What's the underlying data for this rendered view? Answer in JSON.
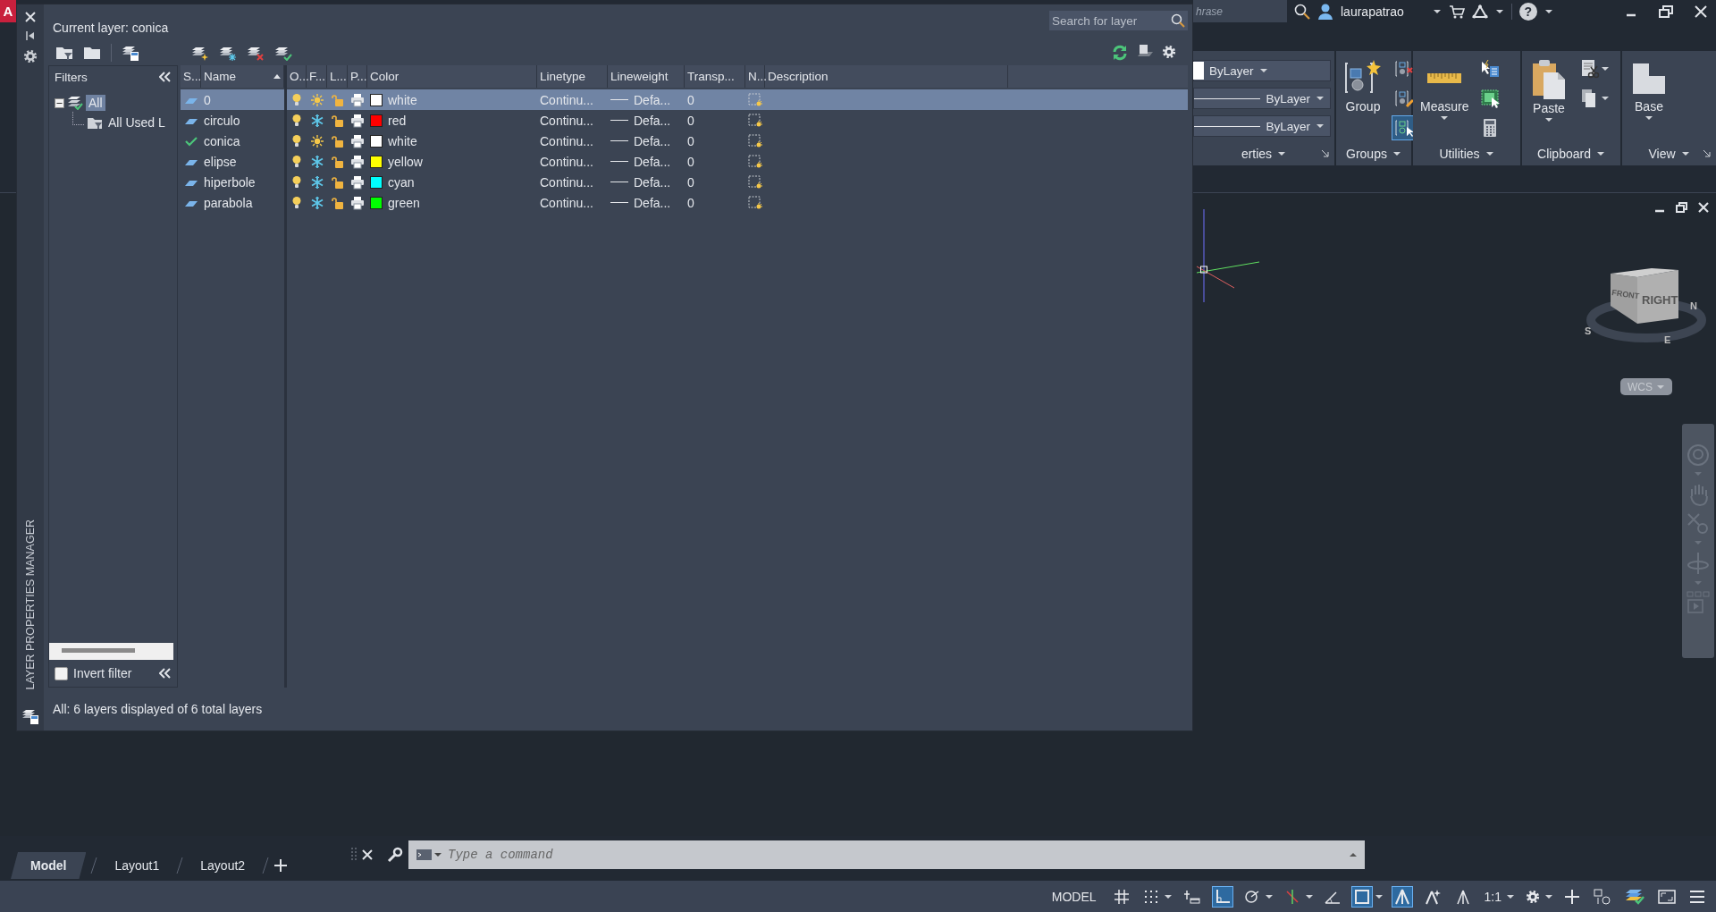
{
  "app_bar": {
    "logo": "A",
    "search": {
      "placeholder": "hrase"
    },
    "user": "laurapatrao",
    "help": "?"
  },
  "ribbon": {
    "panels": [
      {
        "kind": "properties",
        "title": "erties",
        "dropdowns": [
          {
            "kind": "color",
            "value": "ByLayer"
          },
          {
            "kind": "linetype",
            "value": "ByLayer"
          },
          {
            "kind": "lineweight",
            "value": "ByLayer"
          }
        ]
      },
      {
        "kind": "groups",
        "title": "Groups",
        "button": "Group",
        "menu": false,
        "tools": [
          {
            "kind": "ungroup",
            "on": false
          },
          {
            "kind": "group-edit",
            "on": false
          },
          {
            "kind": "group-select",
            "on": true
          }
        ]
      },
      {
        "kind": "utilities",
        "title": "Utilities",
        "button": "Measure",
        "menu": true,
        "tools": [
          {
            "kind": "quick-select",
            "on": false
          },
          {
            "kind": "select-all",
            "on": false
          },
          {
            "kind": "calculator",
            "on": false
          }
        ]
      },
      {
        "kind": "clipboard",
        "title": "Clipboard",
        "button": "Paste",
        "menu": true,
        "tools": [
          {
            "kind": "cut",
            "on": false
          },
          {
            "kind": "copy",
            "on": false
          }
        ]
      },
      {
        "kind": "view",
        "title": "View",
        "button": "Base",
        "menu": true
      }
    ]
  },
  "viewport": {
    "viewcube": {
      "faces": [
        "FRONT",
        "RIGHT"
      ],
      "compass": [
        "S",
        "E",
        "N"
      ]
    },
    "ucs_menu": "WCS"
  },
  "palette": {
    "side_title": "LAYER PROPERTIES MANAGER",
    "current_layer": "Current layer: conica",
    "search": {
      "placeholder": "Search for layer"
    },
    "filters": {
      "title": "Filters",
      "tree": [
        {
          "label": "All",
          "selected": true,
          "expanded": true,
          "children": [
            {
              "label": "All Used L",
              "selected": false
            }
          ]
        }
      ],
      "invert_filter": {
        "label": "Invert filter",
        "checked": false
      }
    },
    "columns": [
      "S...",
      "Name",
      "O...",
      "F...",
      "L...",
      "P...",
      "Color",
      "Linetype",
      "Lineweight",
      "Transp...",
      "N...",
      "Description"
    ],
    "layers": [
      {
        "name": "0",
        "current": false,
        "selected": true,
        "on": true,
        "frozen": false,
        "locked": false,
        "plot": true,
        "color": "#ffffff",
        "color_name": "white",
        "linetype": "Continu...",
        "lineweight": "Defa...",
        "transparency": "0"
      },
      {
        "name": "circulo",
        "current": false,
        "selected": false,
        "on": true,
        "frozen": true,
        "locked": false,
        "plot": true,
        "color": "#ff0000",
        "color_name": "red",
        "linetype": "Continu...",
        "lineweight": "Defa...",
        "transparency": "0"
      },
      {
        "name": "conica",
        "current": true,
        "selected": false,
        "on": true,
        "frozen": false,
        "locked": false,
        "plot": true,
        "color": "#ffffff",
        "color_name": "white",
        "linetype": "Continu...",
        "lineweight": "Defa...",
        "transparency": "0"
      },
      {
        "name": "elipse",
        "current": false,
        "selected": false,
        "on": true,
        "frozen": true,
        "locked": false,
        "plot": true,
        "color": "#ffff00",
        "color_name": "yellow",
        "linetype": "Continu...",
        "lineweight": "Defa...",
        "transparency": "0"
      },
      {
        "name": "hiperbole",
        "current": false,
        "selected": false,
        "on": true,
        "frozen": true,
        "locked": false,
        "plot": true,
        "color": "#00ffff",
        "color_name": "cyan",
        "linetype": "Continu...",
        "lineweight": "Defa...",
        "transparency": "0"
      },
      {
        "name": "parabola",
        "current": false,
        "selected": false,
        "on": true,
        "frozen": true,
        "locked": false,
        "plot": true,
        "color": "#00ff00",
        "color_name": "green",
        "linetype": "Continu...",
        "lineweight": "Defa...",
        "transparency": "0"
      }
    ],
    "status": "All: 6 layers displayed of 6 total layers"
  },
  "layout_tabs": [
    {
      "label": "Model",
      "selected": true
    },
    {
      "label": "Layout1",
      "selected": false
    },
    {
      "label": "Layout2",
      "selected": false
    }
  ],
  "command_line": {
    "placeholder": "Type a command"
  },
  "status_bar": {
    "space": "MODEL",
    "tools": [
      {
        "kind": "grid",
        "on": false,
        "menu": false
      },
      {
        "kind": "snap",
        "on": false,
        "menu": true
      },
      {
        "kind": "infer",
        "on": false,
        "menu": false
      },
      {
        "kind": "ortho",
        "on": true,
        "menu": false
      },
      {
        "kind": "polar",
        "on": false,
        "menu": true
      },
      {
        "kind": "isodraft",
        "on": false,
        "menu": true
      },
      {
        "kind": "angle",
        "on": false,
        "menu": false
      },
      {
        "kind": "selection",
        "on": true,
        "menu": true
      },
      {
        "kind": "annotation",
        "on": true,
        "menu": false
      },
      {
        "kind": "autoscale",
        "on": false,
        "menu": false
      },
      {
        "kind": "annovisibility",
        "on": false,
        "menu": false
      },
      {
        "kind": "scale",
        "label": "1:1",
        "on": false,
        "menu": true
      },
      {
        "kind": "settings",
        "on": false,
        "menu": true
      },
      {
        "kind": "plus",
        "on": false,
        "menu": false
      },
      {
        "kind": "units",
        "on": false,
        "menu": false
      },
      {
        "kind": "isolate",
        "on": false,
        "menu": false
      },
      {
        "kind": "fullscreen",
        "on": false,
        "menu": false
      },
      {
        "kind": "menu",
        "on": false,
        "menu": false
      }
    ]
  }
}
